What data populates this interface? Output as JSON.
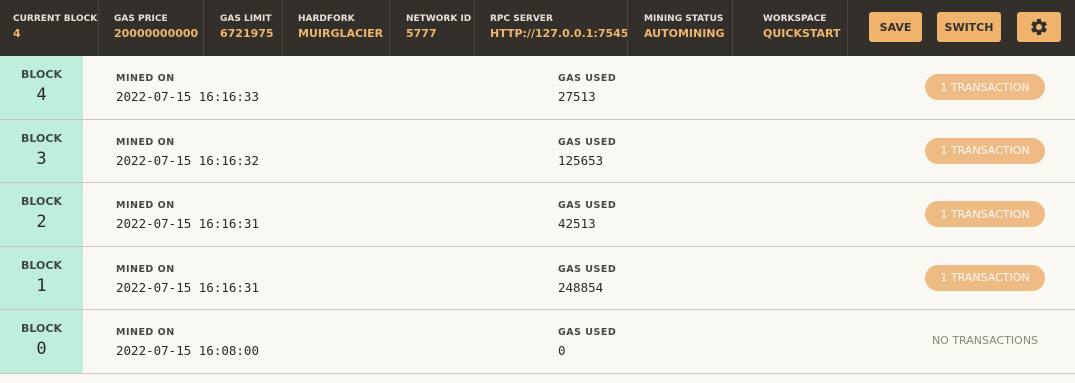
{
  "header": {
    "stats": [
      {
        "label": "CURRENT BLOCK",
        "value": "4"
      },
      {
        "label": "GAS PRICE",
        "value": "20000000000"
      },
      {
        "label": "GAS LIMIT",
        "value": "6721975"
      },
      {
        "label": "HARDFORK",
        "value": "MUIRGLACIER"
      },
      {
        "label": "NETWORK ID",
        "value": "5777"
      },
      {
        "label": "RPC SERVER",
        "value": "HTTP://127.0.0.1:7545"
      },
      {
        "label": "MINING STATUS",
        "value": "AUTOMINING"
      },
      {
        "label": "WORKSPACE",
        "value": "QUICKSTART"
      }
    ],
    "save_label": "SAVE",
    "switch_label": "SWITCH",
    "settings_icon": "gear-icon"
  },
  "blocks": {
    "block_label": "BLOCK",
    "mined_on_label": "MINED ON",
    "gas_used_label": "GAS USED",
    "rows": [
      {
        "number": "4",
        "mined_on": "2022-07-15 16:16:33",
        "gas_used": "27513",
        "transactions": "1 TRANSACTION"
      },
      {
        "number": "3",
        "mined_on": "2022-07-15 16:16:32",
        "gas_used": "125653",
        "transactions": "1 TRANSACTION"
      },
      {
        "number": "2",
        "mined_on": "2022-07-15 16:16:31",
        "gas_used": "42513",
        "transactions": "1 TRANSACTION"
      },
      {
        "number": "1",
        "mined_on": "2022-07-15 16:16:31",
        "gas_used": "248854",
        "transactions": "1 TRANSACTION"
      },
      {
        "number": "0",
        "mined_on": "2022-07-15 16:08:00",
        "gas_used": "0",
        "transactions": "NO TRANSACTIONS"
      }
    ]
  },
  "colors": {
    "header_bg": "#33302c",
    "accent": "#efb36b",
    "block_cell": "#bfeedc",
    "badge": "#eebb85",
    "row_bg": "#faf8f3"
  }
}
